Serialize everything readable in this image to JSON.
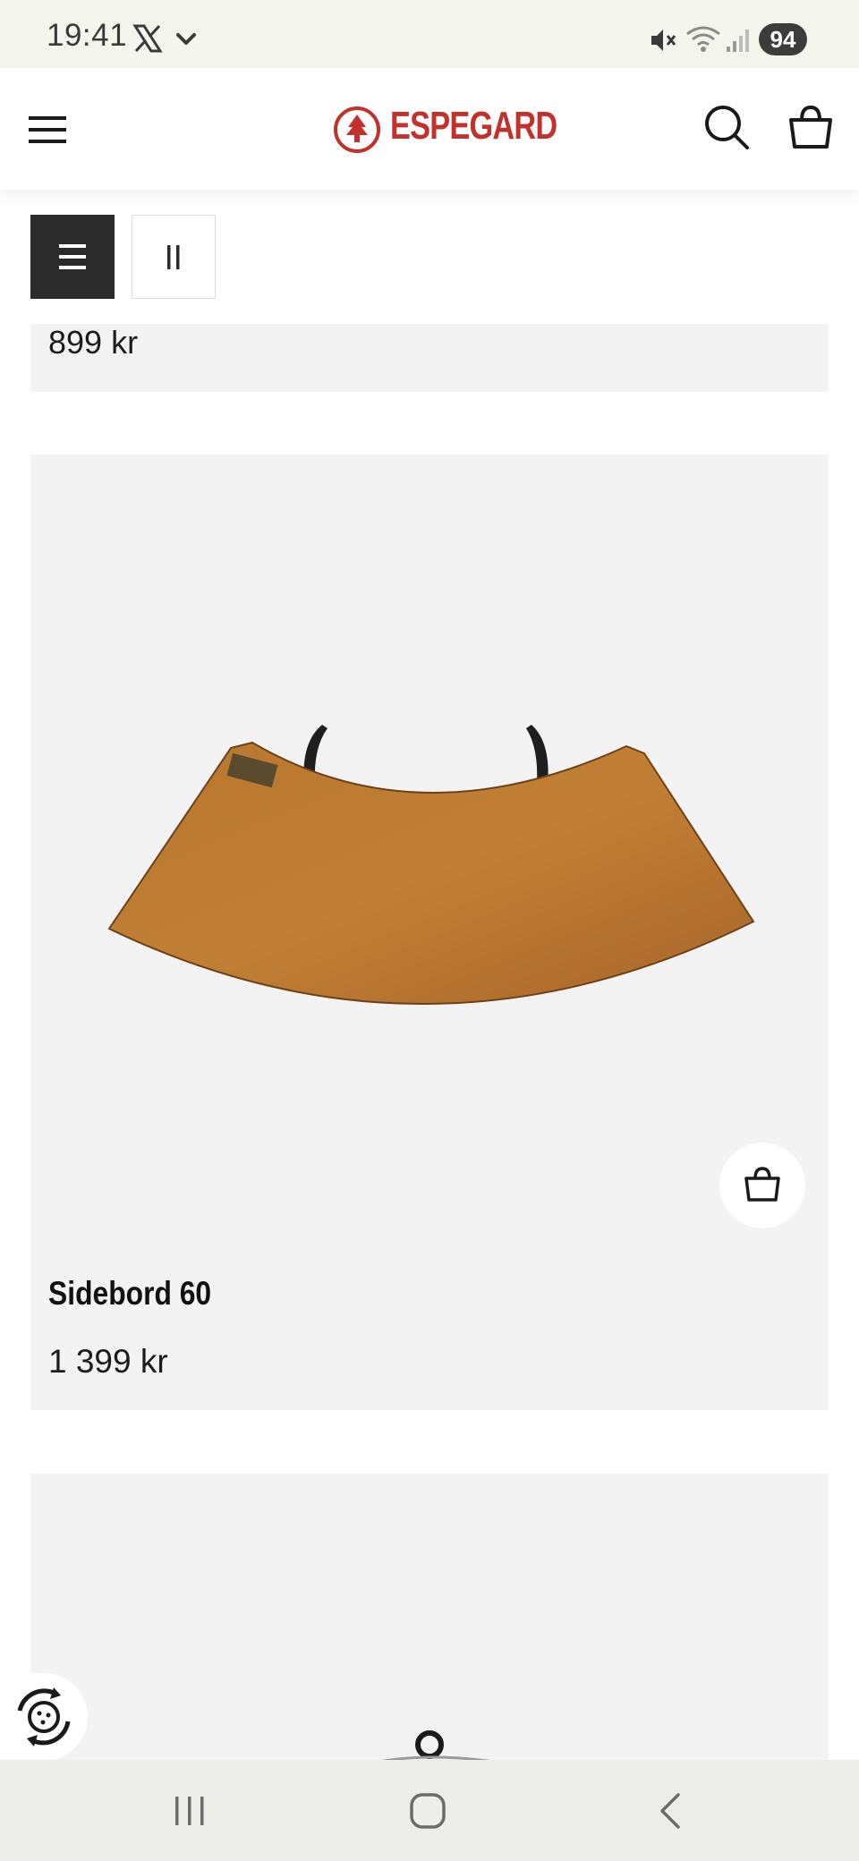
{
  "status_bar": {
    "time": "19:41",
    "battery": "94",
    "icons": [
      "x-logo-icon",
      "chevron-down-icon",
      "mute-icon",
      "wifi-icon",
      "signal-icon",
      "battery-icon"
    ]
  },
  "header": {
    "brand": "ESPEGARD",
    "brand_color": "#c0322b",
    "icons": [
      "hamburger-menu-icon",
      "search-icon",
      "shopping-bag-icon"
    ]
  },
  "view_toggle": {
    "active": "list",
    "options": [
      "list-view-icon",
      "grid-view-icon"
    ]
  },
  "products": {
    "previous": {
      "price": "899 kr"
    },
    "current": {
      "title": "Sidebord 60",
      "price": "1 399 kr"
    }
  },
  "nav_bar": {
    "icons": [
      "recent-apps-icon",
      "home-icon",
      "back-icon"
    ]
  }
}
